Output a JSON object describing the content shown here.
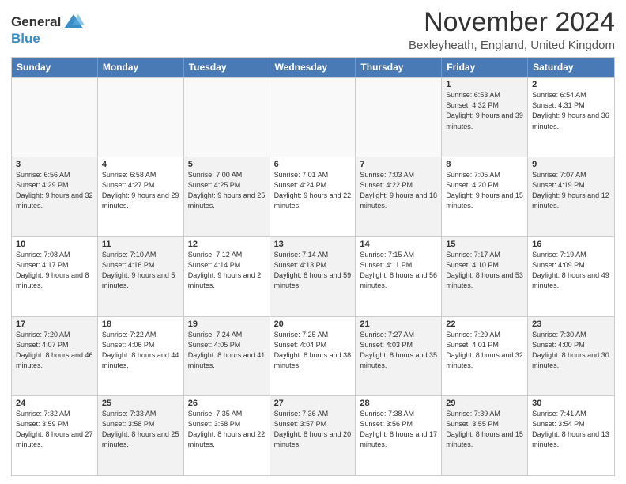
{
  "logo": {
    "line1": "General",
    "line2": "Blue"
  },
  "title": "November 2024",
  "location": "Bexleyheath, England, United Kingdom",
  "header_days": [
    "Sunday",
    "Monday",
    "Tuesday",
    "Wednesday",
    "Thursday",
    "Friday",
    "Saturday"
  ],
  "weeks": [
    [
      {
        "day": "",
        "info": "",
        "empty": true
      },
      {
        "day": "",
        "info": "",
        "empty": true
      },
      {
        "day": "",
        "info": "",
        "empty": true
      },
      {
        "day": "",
        "info": "",
        "empty": true
      },
      {
        "day": "",
        "info": "",
        "empty": true
      },
      {
        "day": "1",
        "info": "Sunrise: 6:53 AM\nSunset: 4:32 PM\nDaylight: 9 hours\nand 39 minutes.",
        "empty": false,
        "shaded": true
      },
      {
        "day": "2",
        "info": "Sunrise: 6:54 AM\nSunset: 4:31 PM\nDaylight: 9 hours\nand 36 minutes.",
        "empty": false,
        "shaded": false
      }
    ],
    [
      {
        "day": "3",
        "info": "Sunrise: 6:56 AM\nSunset: 4:29 PM\nDaylight: 9 hours\nand 32 minutes.",
        "empty": false,
        "shaded": true
      },
      {
        "day": "4",
        "info": "Sunrise: 6:58 AM\nSunset: 4:27 PM\nDaylight: 9 hours\nand 29 minutes.",
        "empty": false,
        "shaded": false
      },
      {
        "day": "5",
        "info": "Sunrise: 7:00 AM\nSunset: 4:25 PM\nDaylight: 9 hours\nand 25 minutes.",
        "empty": false,
        "shaded": true
      },
      {
        "day": "6",
        "info": "Sunrise: 7:01 AM\nSunset: 4:24 PM\nDaylight: 9 hours\nand 22 minutes.",
        "empty": false,
        "shaded": false
      },
      {
        "day": "7",
        "info": "Sunrise: 7:03 AM\nSunset: 4:22 PM\nDaylight: 9 hours\nand 18 minutes.",
        "empty": false,
        "shaded": true
      },
      {
        "day": "8",
        "info": "Sunrise: 7:05 AM\nSunset: 4:20 PM\nDaylight: 9 hours\nand 15 minutes.",
        "empty": false,
        "shaded": false
      },
      {
        "day": "9",
        "info": "Sunrise: 7:07 AM\nSunset: 4:19 PM\nDaylight: 9 hours\nand 12 minutes.",
        "empty": false,
        "shaded": true
      }
    ],
    [
      {
        "day": "10",
        "info": "Sunrise: 7:08 AM\nSunset: 4:17 PM\nDaylight: 9 hours\nand 8 minutes.",
        "empty": false,
        "shaded": false
      },
      {
        "day": "11",
        "info": "Sunrise: 7:10 AM\nSunset: 4:16 PM\nDaylight: 9 hours\nand 5 minutes.",
        "empty": false,
        "shaded": true
      },
      {
        "day": "12",
        "info": "Sunrise: 7:12 AM\nSunset: 4:14 PM\nDaylight: 9 hours\nand 2 minutes.",
        "empty": false,
        "shaded": false
      },
      {
        "day": "13",
        "info": "Sunrise: 7:14 AM\nSunset: 4:13 PM\nDaylight: 8 hours\nand 59 minutes.",
        "empty": false,
        "shaded": true
      },
      {
        "day": "14",
        "info": "Sunrise: 7:15 AM\nSunset: 4:11 PM\nDaylight: 8 hours\nand 56 minutes.",
        "empty": false,
        "shaded": false
      },
      {
        "day": "15",
        "info": "Sunrise: 7:17 AM\nSunset: 4:10 PM\nDaylight: 8 hours\nand 53 minutes.",
        "empty": false,
        "shaded": true
      },
      {
        "day": "16",
        "info": "Sunrise: 7:19 AM\nSunset: 4:09 PM\nDaylight: 8 hours\nand 49 minutes.",
        "empty": false,
        "shaded": false
      }
    ],
    [
      {
        "day": "17",
        "info": "Sunrise: 7:20 AM\nSunset: 4:07 PM\nDaylight: 8 hours\nand 46 minutes.",
        "empty": false,
        "shaded": true
      },
      {
        "day": "18",
        "info": "Sunrise: 7:22 AM\nSunset: 4:06 PM\nDaylight: 8 hours\nand 44 minutes.",
        "empty": false,
        "shaded": false
      },
      {
        "day": "19",
        "info": "Sunrise: 7:24 AM\nSunset: 4:05 PM\nDaylight: 8 hours\nand 41 minutes.",
        "empty": false,
        "shaded": true
      },
      {
        "day": "20",
        "info": "Sunrise: 7:25 AM\nSunset: 4:04 PM\nDaylight: 8 hours\nand 38 minutes.",
        "empty": false,
        "shaded": false
      },
      {
        "day": "21",
        "info": "Sunrise: 7:27 AM\nSunset: 4:03 PM\nDaylight: 8 hours\nand 35 minutes.",
        "empty": false,
        "shaded": true
      },
      {
        "day": "22",
        "info": "Sunrise: 7:29 AM\nSunset: 4:01 PM\nDaylight: 8 hours\nand 32 minutes.",
        "empty": false,
        "shaded": false
      },
      {
        "day": "23",
        "info": "Sunrise: 7:30 AM\nSunset: 4:00 PM\nDaylight: 8 hours\nand 30 minutes.",
        "empty": false,
        "shaded": true
      }
    ],
    [
      {
        "day": "24",
        "info": "Sunrise: 7:32 AM\nSunset: 3:59 PM\nDaylight: 8 hours\nand 27 minutes.",
        "empty": false,
        "shaded": false
      },
      {
        "day": "25",
        "info": "Sunrise: 7:33 AM\nSunset: 3:58 PM\nDaylight: 8 hours\nand 25 minutes.",
        "empty": false,
        "shaded": true
      },
      {
        "day": "26",
        "info": "Sunrise: 7:35 AM\nSunset: 3:58 PM\nDaylight: 8 hours\nand 22 minutes.",
        "empty": false,
        "shaded": false
      },
      {
        "day": "27",
        "info": "Sunrise: 7:36 AM\nSunset: 3:57 PM\nDaylight: 8 hours\nand 20 minutes.",
        "empty": false,
        "shaded": true
      },
      {
        "day": "28",
        "info": "Sunrise: 7:38 AM\nSunset: 3:56 PM\nDaylight: 8 hours\nand 17 minutes.",
        "empty": false,
        "shaded": false
      },
      {
        "day": "29",
        "info": "Sunrise: 7:39 AM\nSunset: 3:55 PM\nDaylight: 8 hours\nand 15 minutes.",
        "empty": false,
        "shaded": true
      },
      {
        "day": "30",
        "info": "Sunrise: 7:41 AM\nSunset: 3:54 PM\nDaylight: 8 hours\nand 13 minutes.",
        "empty": false,
        "shaded": false
      }
    ]
  ]
}
